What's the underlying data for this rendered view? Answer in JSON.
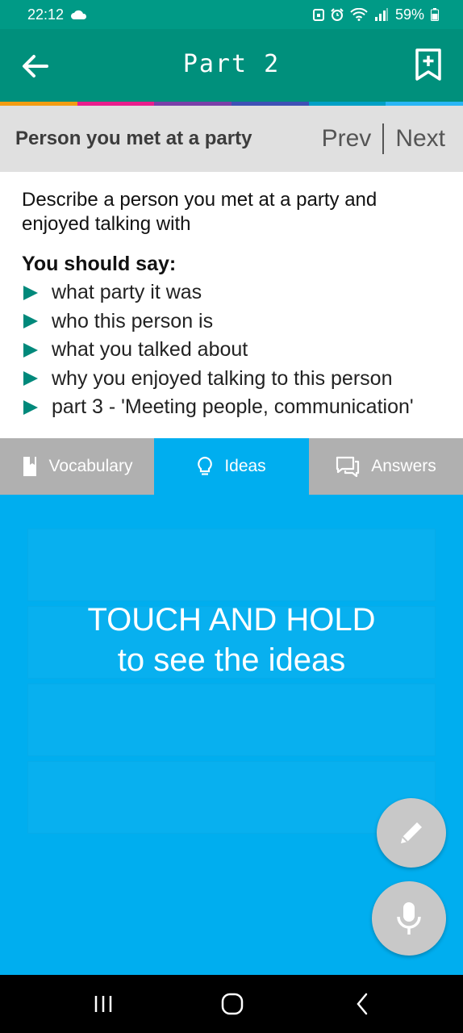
{
  "status": {
    "time": "22:12",
    "battery": "59%"
  },
  "appbar": {
    "title": "Part 2"
  },
  "strip_colors": [
    "#f39c12",
    "#e91e8c",
    "#7b3fa8",
    "#3f51b5",
    "#00a0c6",
    "#29b6f6",
    "#8bc34a"
  ],
  "topic": {
    "title": "Person you met at a party",
    "prev": "Prev",
    "next": "Next"
  },
  "cue": {
    "prompt": "Describe a person you met at a party and enjoyed talking with",
    "should_say": "You should say:",
    "points": [
      "what party it was",
      "who this person is",
      "what you talked about",
      "why you enjoyed talking to this person",
      "part 3 - 'Meeting people, communication'"
    ]
  },
  "tabs": {
    "vocabulary": "Vocabulary",
    "ideas": "Ideas",
    "answers": "Answers"
  },
  "ideas": {
    "hint_line1": "TOUCH AND HOLD",
    "hint_line2": "to see the ideas"
  },
  "colors": {
    "teal": "#00907c",
    "accent_blue": "#00aeef",
    "tab_gray": "#b0b0b0"
  }
}
